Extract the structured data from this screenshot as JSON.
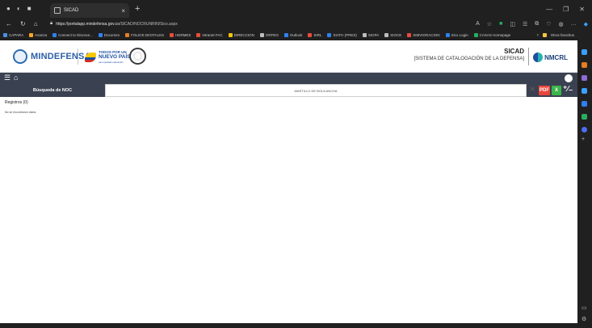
{
  "browser": {
    "tab_title": "SICAD",
    "url_host": "https://portalapp.mindefensa.gov.co",
    "url_path": "/SICAD/NOCRUNRIN/Sico.aspx",
    "bookmarks": [
      {
        "label": "CAPARA",
        "color": "#4a90e2"
      },
      {
        "label": "Avanza",
        "color": "#f5a623"
      },
      {
        "label": "Connect to Discove...",
        "color": "#2f80ed"
      },
      {
        "label": "Documen",
        "color": "#2f80ed"
      },
      {
        "label": "FOLIOS DIGITALES",
        "color": "#e67e22"
      },
      {
        "label": "HERMES",
        "color": "#e74c3c"
      },
      {
        "label": "Intranet FAC",
        "color": "#e74c3c"
      },
      {
        "label": "DIRECCION",
        "color": "#f1c40f"
      },
      {
        "label": "ORFEO",
        "color": "#bdbdbd"
      },
      {
        "label": "Outlook",
        "color": "#2f80ed"
      },
      {
        "label": "SIRL",
        "color": "#e74c3c"
      },
      {
        "label": "SIATH (PRES)",
        "color": "#2f80ed"
      },
      {
        "label": "SIGPA",
        "color": "#bdbdbd"
      },
      {
        "label": "SIOCE",
        "color": "#bdbdbd"
      },
      {
        "label": "SIMVIGRACION",
        "color": "#e74c3c"
      },
      {
        "label": "Sico Login",
        "color": "#2f80ed"
      },
      {
        "label": "CASAS Homepage",
        "color": "#27ae60"
      }
    ],
    "other_bookmarks": "Otros favoritos"
  },
  "header": {
    "logo_text": "MINDEFENSA",
    "np_top": "TODOS POR UN",
    "np_big": "NUEVO PAÍS",
    "np_sub": "paz equidad educación",
    "sicad_title": "SICAD",
    "sicad_subtitle": "[SISTEMA DE CATALOGACIÓN DE LA DEFENSA]",
    "nmcrl": "NMCRL"
  },
  "toolbar": {
    "search_label": "Búsqueda de NOC",
    "search_value": "MARTILLO DE BOLA ANCHA",
    "pdf_label": "PDF",
    "excel_label": "X"
  },
  "content": {
    "registros": "Registros (0)",
    "empty_message": "No se encontraron datos"
  }
}
